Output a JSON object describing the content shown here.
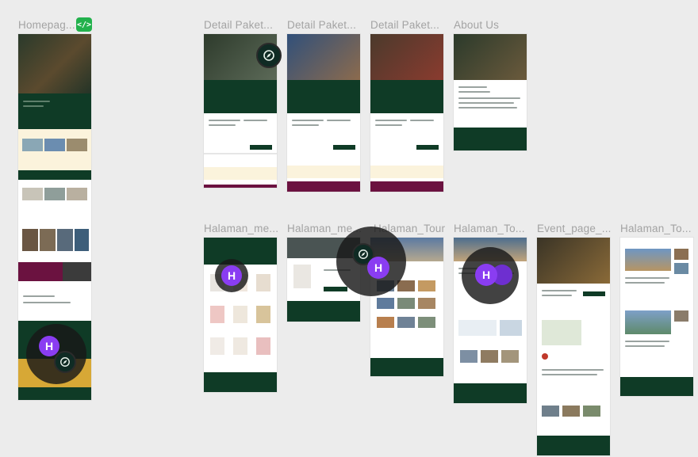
{
  "canvas": {
    "frames": [
      {
        "id": "home",
        "label": "Homepag..."
      },
      {
        "id": "detail1",
        "label": "Detail Paket..."
      },
      {
        "id": "detail2",
        "label": "Detail Paket..."
      },
      {
        "id": "detail3",
        "label": "Detail Paket..."
      },
      {
        "id": "about",
        "label": "About Us"
      },
      {
        "id": "merch1",
        "label": "Halaman_me..."
      },
      {
        "id": "merch2",
        "label": "Halaman_me..."
      },
      {
        "id": "tour",
        "label": "Halaman_Tour"
      },
      {
        "id": "tour2",
        "label": "Halaman_To..."
      },
      {
        "id": "event",
        "label": "Event_page_..."
      },
      {
        "id": "tour3",
        "label": "Halaman_To..."
      }
    ],
    "dev_mode_badge": "</>",
    "collaborators": [
      {
        "initial": "H",
        "color": "#8a3df2"
      },
      {
        "initial": "H",
        "color": "#8a3df2"
      },
      {
        "initial": "H",
        "color": "#8a3df2"
      },
      {
        "initial": "H",
        "color": "#8a3df2"
      }
    ],
    "colors": {
      "canvas_bg": "#ececec",
      "label": "#a3a3a3",
      "brand_green": "#0f3b26",
      "accent_maroon": "#6b1240",
      "accent_cream": "#fbf3dc",
      "accent_gold": "#d7a836",
      "dev_badge": "#22b14c",
      "cursor_disc": "#181818",
      "avatar": "#8a3df2"
    },
    "icons": [
      "code-icon",
      "compass-logo-icon"
    ]
  }
}
